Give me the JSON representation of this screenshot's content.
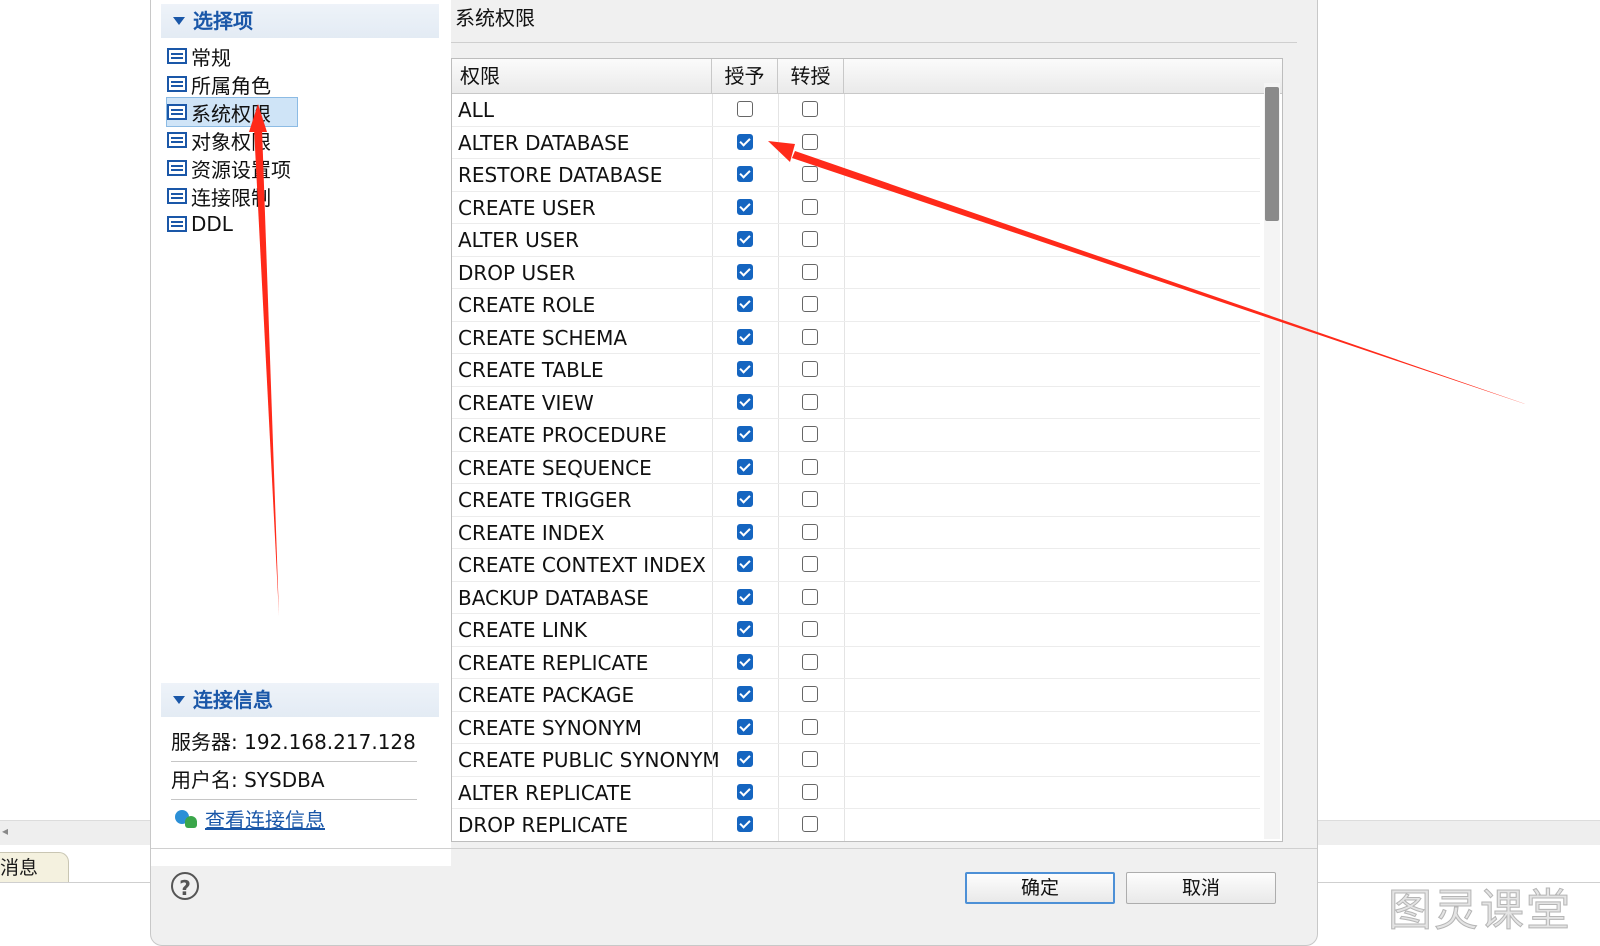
{
  "background": {
    "bottom_tab_label": "消息"
  },
  "left_pane": {
    "options_header": "选择项",
    "nav_items": [
      {
        "label": "常规",
        "selected": false
      },
      {
        "label": "所属角色",
        "selected": false
      },
      {
        "label": "系统权限",
        "selected": true
      },
      {
        "label": "对象权限",
        "selected": false
      },
      {
        "label": "资源设置项",
        "selected": false
      },
      {
        "label": "连接限制",
        "selected": false
      },
      {
        "label": "DDL",
        "selected": false
      }
    ],
    "connection_header": "连接信息",
    "server_label": "服务器: 192.168.217.128",
    "user_label": "用户名: SYSDBA",
    "view_link": "查看连接信息"
  },
  "right_pane": {
    "title": "系统权限",
    "columns": {
      "permission": "权限",
      "grant": "授予",
      "admin": "转授"
    },
    "rows": [
      {
        "name": "ALL",
        "grant": false,
        "admin": false
      },
      {
        "name": "ALTER DATABASE",
        "grant": true,
        "admin": false
      },
      {
        "name": "RESTORE DATABASE",
        "grant": true,
        "admin": false
      },
      {
        "name": "CREATE USER",
        "grant": true,
        "admin": false
      },
      {
        "name": "ALTER USER",
        "grant": true,
        "admin": false
      },
      {
        "name": "DROP USER",
        "grant": true,
        "admin": false
      },
      {
        "name": "CREATE ROLE",
        "grant": true,
        "admin": false
      },
      {
        "name": "CREATE SCHEMA",
        "grant": true,
        "admin": false
      },
      {
        "name": "CREATE TABLE",
        "grant": true,
        "admin": false
      },
      {
        "name": "CREATE VIEW",
        "grant": true,
        "admin": false
      },
      {
        "name": "CREATE PROCEDURE",
        "grant": true,
        "admin": false
      },
      {
        "name": "CREATE SEQUENCE",
        "grant": true,
        "admin": false
      },
      {
        "name": "CREATE TRIGGER",
        "grant": true,
        "admin": false
      },
      {
        "name": "CREATE INDEX",
        "grant": true,
        "admin": false
      },
      {
        "name": "CREATE CONTEXT INDEX",
        "grant": true,
        "admin": false
      },
      {
        "name": "BACKUP DATABASE",
        "grant": true,
        "admin": false
      },
      {
        "name": "CREATE LINK",
        "grant": true,
        "admin": false
      },
      {
        "name": "CREATE REPLICATE",
        "grant": true,
        "admin": false
      },
      {
        "name": "CREATE PACKAGE",
        "grant": true,
        "admin": false
      },
      {
        "name": "CREATE SYNONYM",
        "grant": true,
        "admin": false
      },
      {
        "name": "CREATE PUBLIC SYNONYM",
        "grant": true,
        "admin": false
      },
      {
        "name": "ALTER REPLICATE",
        "grant": true,
        "admin": false
      },
      {
        "name": "DROP REPLICATE",
        "grant": true,
        "admin": false
      }
    ]
  },
  "footer": {
    "help_glyph": "?",
    "ok_label": "确定",
    "cancel_label": "取消"
  },
  "watermark": "图灵课堂",
  "colors": {
    "accent": "#1a57a8",
    "checkbox_checked": "#1565c0",
    "annotation_arrow": "#ff2a1a"
  }
}
